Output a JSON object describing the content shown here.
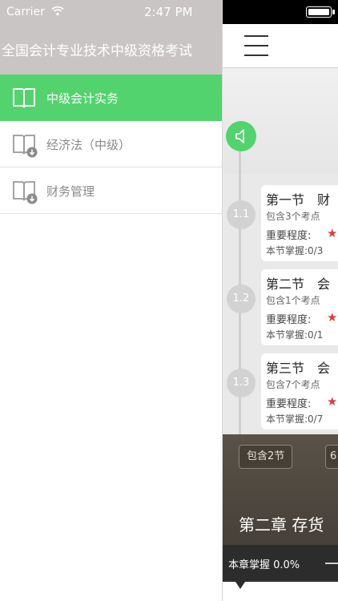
{
  "status_bar": {
    "carrier": "Carrier",
    "time": "2:47 PM"
  },
  "drawer": {
    "title": "全国会计专业技术中级资格考试",
    "items": [
      {
        "label": "中级会计实务",
        "icon": "book-open-icon",
        "selected": true
      },
      {
        "label": "经济法（中级）",
        "icon": "book-download-icon",
        "selected": false
      },
      {
        "label": "财务管理",
        "icon": "book-download-icon",
        "selected": false
      }
    ]
  },
  "main": {
    "sections": [
      {
        "node": "1.1",
        "title": "第一节　财",
        "points": "包含3个考点",
        "importance_label": "重要程度:",
        "star": "★",
        "mastery": "本节掌握:0/3"
      },
      {
        "node": "1.2",
        "title": "第二节　会",
        "points": "包含1个考点",
        "importance_label": "重要程度:",
        "star": "★",
        "mastery": "本节掌握:0/1"
      },
      {
        "node": "1.3",
        "title": "第三节　会",
        "points": "包含7个考点",
        "importance_label": "重要程度:",
        "star": "★",
        "mastery": "本节掌握:0/7"
      }
    ],
    "chapter": {
      "sections_pill": "包含2节",
      "second_pill": "6",
      "title": "第二章  存货",
      "mastery": "本章掌握 0.0%"
    }
  },
  "colors": {
    "accent_green": "#52d36d",
    "star_red": "#e03b3b",
    "header_gray": "#c9c5c5"
  }
}
